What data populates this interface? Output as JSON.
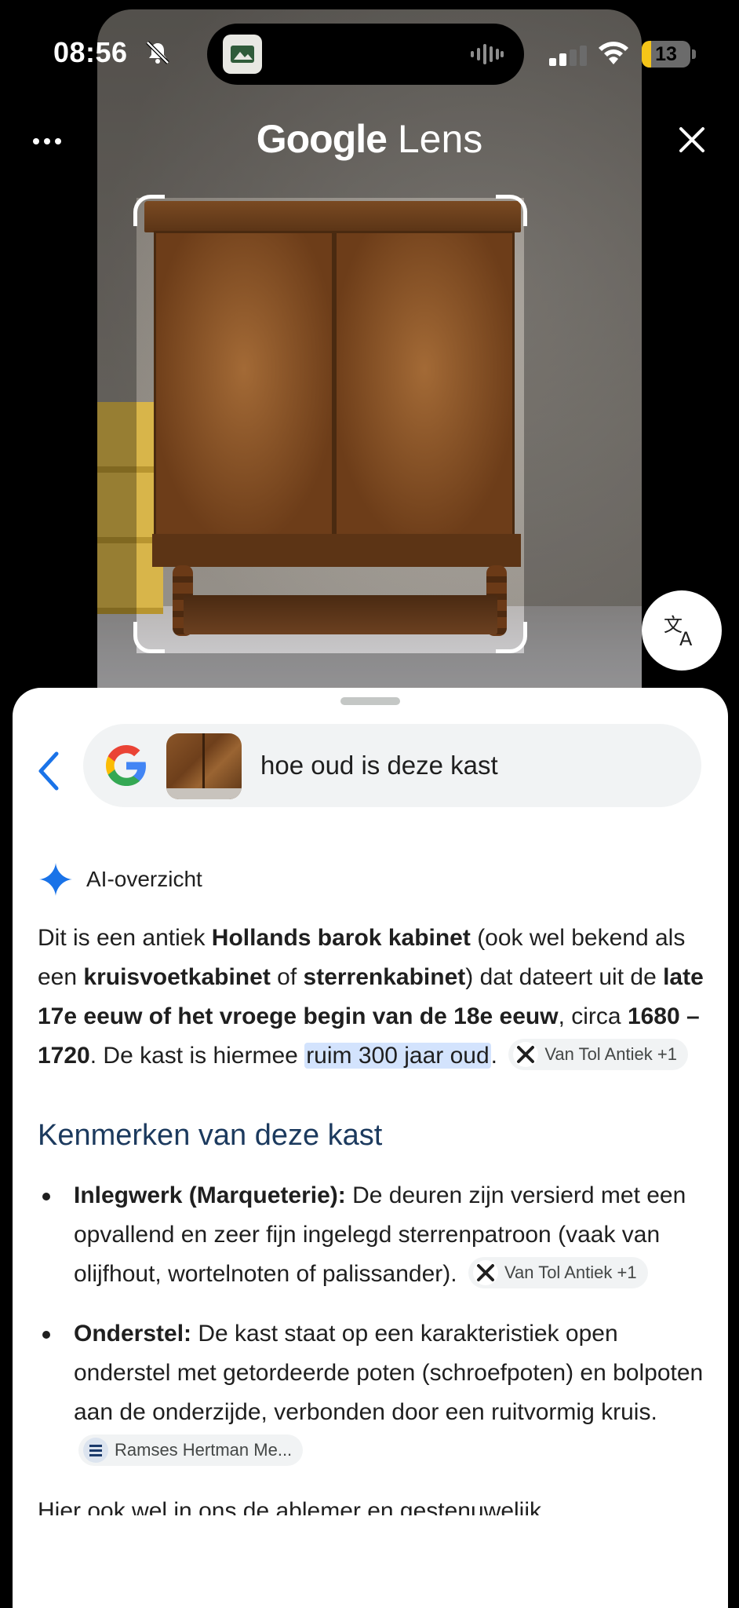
{
  "status_bar": {
    "time": "08:56",
    "battery": "13",
    "battery_color": "#f5c518"
  },
  "header": {
    "title_brand": "Google",
    "title_product": "Lens",
    "more_icon": "more-horizontal-icon",
    "close_icon": "close-icon",
    "translate_icon": "translate-icon"
  },
  "search": {
    "query": "hoe oud is deze kast",
    "back_icon": "back-arrow-icon",
    "logo": "google-g-logo"
  },
  "ai_overview": {
    "label": "AI-overzicht",
    "intro": {
      "t1": "Dit is een antiek ",
      "b1": "Hollands barok kabinet",
      "t2": " (ook wel bekend als een ",
      "b2": "kruisvoetkabinet",
      "t3": " of ",
      "b3": "sterrenkabinet",
      "t4": ") dat dateert uit de ",
      "b4": "late 17e eeuw of het vroege begin van de 18e eeuw",
      "t5": ", circa ",
      "b5": "1680 – 1720",
      "t6": ". De kast is hiermee ",
      "highlight": "ruim 300 jaar oud",
      "t7": ".",
      "source": "Van Tol Antiek +1"
    },
    "section_title": "Kenmerken van deze kast",
    "features": [
      {
        "title": "Inlegwerk (Marqueterie):",
        "text": " De deuren zijn versierd met een opvallend en zeer fijn ingelegd sterrenpatroon (vaak van olijfhout, wortelnoten of palissander).",
        "source": "Van Tol Antiek +1"
      },
      {
        "title": "Onderstel:",
        "text": " De kast staat op een karakteristiek open onderstel met getordeerde poten (schroefpoten) en bolpoten aan de onderzijde, verbonden door een ruitvormig kruis.",
        "source": "Ramses Hertman Me..."
      }
    ],
    "cutoff_text": "Hier ook wel in ons de ablemer en gestenuwelijk"
  },
  "colors": {
    "accent_blue": "#1a73e8",
    "heading": "#1c3a5e",
    "highlight": "#d3e3fd"
  }
}
